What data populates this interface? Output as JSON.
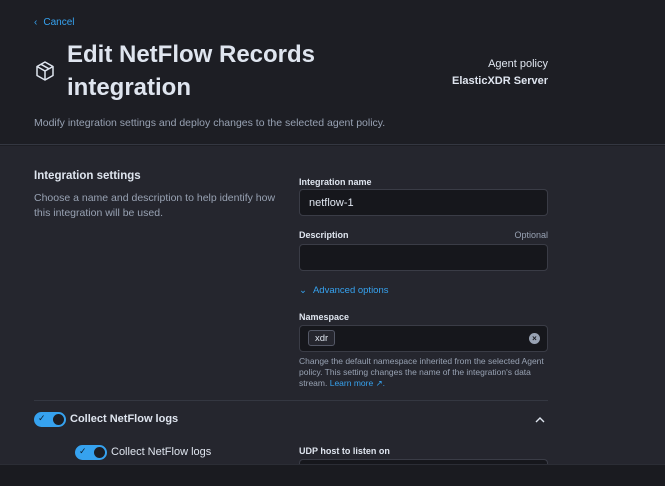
{
  "header": {
    "cancel_label": "Cancel",
    "title": "Edit NetFlow Records integration",
    "policy_label": "Agent policy",
    "policy_name": "ElasticXDR Server",
    "subtitle": "Modify integration settings and deploy changes to the selected agent policy."
  },
  "integration_settings": {
    "title": "Integration settings",
    "description": "Choose a name and description to help identify how this integration will be used.",
    "name_label": "Integration name",
    "name_value": "netflow-1",
    "description_label": "Description",
    "description_optional": "Optional",
    "description_value": "",
    "advanced_options_label": "Advanced options",
    "namespace_label": "Namespace",
    "namespace_value": "xdr",
    "namespace_help": "Change the default namespace inherited from the selected Agent policy. This setting changes the name of the integration's data stream.",
    "learn_more": "Learn more"
  },
  "collect": {
    "section_label": "Collect NetFlow logs",
    "sub_label": "Collect NetFlow logs",
    "udp_host_label": "UDP host to listen on"
  },
  "colors": {
    "accent": "#36a2ef",
    "background": "#1d1e24",
    "panel": "#25262e"
  }
}
